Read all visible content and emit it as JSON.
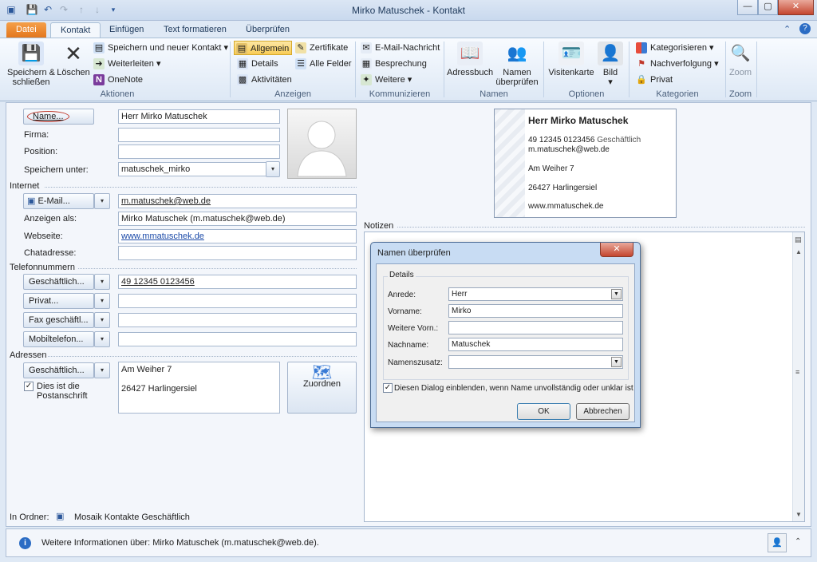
{
  "window": {
    "title": "Mirko Matuschek  -  Kontakt"
  },
  "tabs": [
    "Datei",
    "Kontakt",
    "Einfügen",
    "Text formatieren",
    "Überprüfen"
  ],
  "ribbon": {
    "aktionen": {
      "save_close": "Speichern & schließen",
      "delete": "Löschen",
      "save_new": "Speichern und neuer Kontakt",
      "forward": "Weiterleiten",
      "onenote": "OneNote",
      "label": "Aktionen"
    },
    "anzeigen": {
      "allgemein": "Allgemein",
      "details": "Details",
      "aktivitaeten": "Aktivitäten",
      "zertifikate": "Zertifikate",
      "alle_felder": "Alle Felder",
      "label": "Anzeigen"
    },
    "kommunizieren": {
      "email": "E-Mail-Nachricht",
      "besprechung": "Besprechung",
      "weitere": "Weitere",
      "label": "Kommunizieren"
    },
    "namen": {
      "adressbuch": "Adressbuch",
      "pruefen": "Namen überprüfen",
      "label": "Namen"
    },
    "optionen": {
      "visitenkarte": "Visitenkarte",
      "bild": "Bild",
      "label": "Optionen"
    },
    "kategorien": {
      "kategorisieren": "Kategorisieren",
      "nachverfolgung": "Nachverfolgung",
      "privat": "Privat",
      "label": "Kategorien"
    },
    "zoom": {
      "zoom": "Zoom",
      "label": "Zoom"
    }
  },
  "form": {
    "name_btn": "Name...",
    "name_val": "Herr Mirko Matuschek",
    "firma_lbl": "Firma:",
    "position_lbl": "Position:",
    "speichern_lbl": "Speichern unter:",
    "speichern_val": "matuschek_mirko",
    "internet": "Internet",
    "email_btn": "E-Mail...",
    "email_val": "m.matuschek@web.de",
    "anzeigen_lbl": "Anzeigen als:",
    "anzeigen_val": "Mirko Matuschek (m.matuschek@web.de)",
    "webseite_lbl": "Webseite:",
    "webseite_val": "www.mmatuschek.de",
    "chat_lbl": "Chatadresse:",
    "telefon": "Telefonnummern",
    "tel1_btn": "Geschäftlich...",
    "tel1_val": "49 12345 0123456",
    "tel2_btn": "Privat...",
    "tel3_btn": "Fax geschäftl...",
    "tel4_btn": "Mobiltelefon...",
    "adressen": "Adressen",
    "adr_btn": "Geschäftlich...",
    "adr_line1": "Am Weiher 7",
    "adr_line2": "26427  Harlingersiel",
    "postanschrift": "Dies ist die Postanschrift",
    "zuordnen": "Zuordnen",
    "notizen": "Notizen",
    "ordner_lbl": "In Ordner:",
    "ordner_val": "Mosaik Kontakte Geschäftlich"
  },
  "card": {
    "name": "Herr Mirko Matuschek",
    "phone": "49 12345 0123456",
    "phone_type": "Geschäftlich",
    "email": "m.matuschek@web.de",
    "street": "Am Weiher 7",
    "city": "26427  Harlingersiel",
    "web": "www.mmatuschek.de"
  },
  "dialog": {
    "title": "Namen überprüfen",
    "group": "Details",
    "anrede_lbl": "Anrede:",
    "anrede_val": "Herr",
    "vorname_lbl": "Vorname:",
    "vorname_val": "Mirko",
    "weitere_lbl": "Weitere Vorn.:",
    "weitere_val": "",
    "nachname_lbl": "Nachname:",
    "nachname_val": "Matuschek",
    "zusatz_lbl": "Namenszusatz:",
    "zusatz_val": "",
    "checkbox": "Diesen Dialog einblenden, wenn Name unvollständig oder unklar ist",
    "ok": "OK",
    "cancel": "Abbrechen"
  },
  "status": {
    "text": "Weitere Informationen über: Mirko Matuschek (m.matuschek@web.de)."
  }
}
